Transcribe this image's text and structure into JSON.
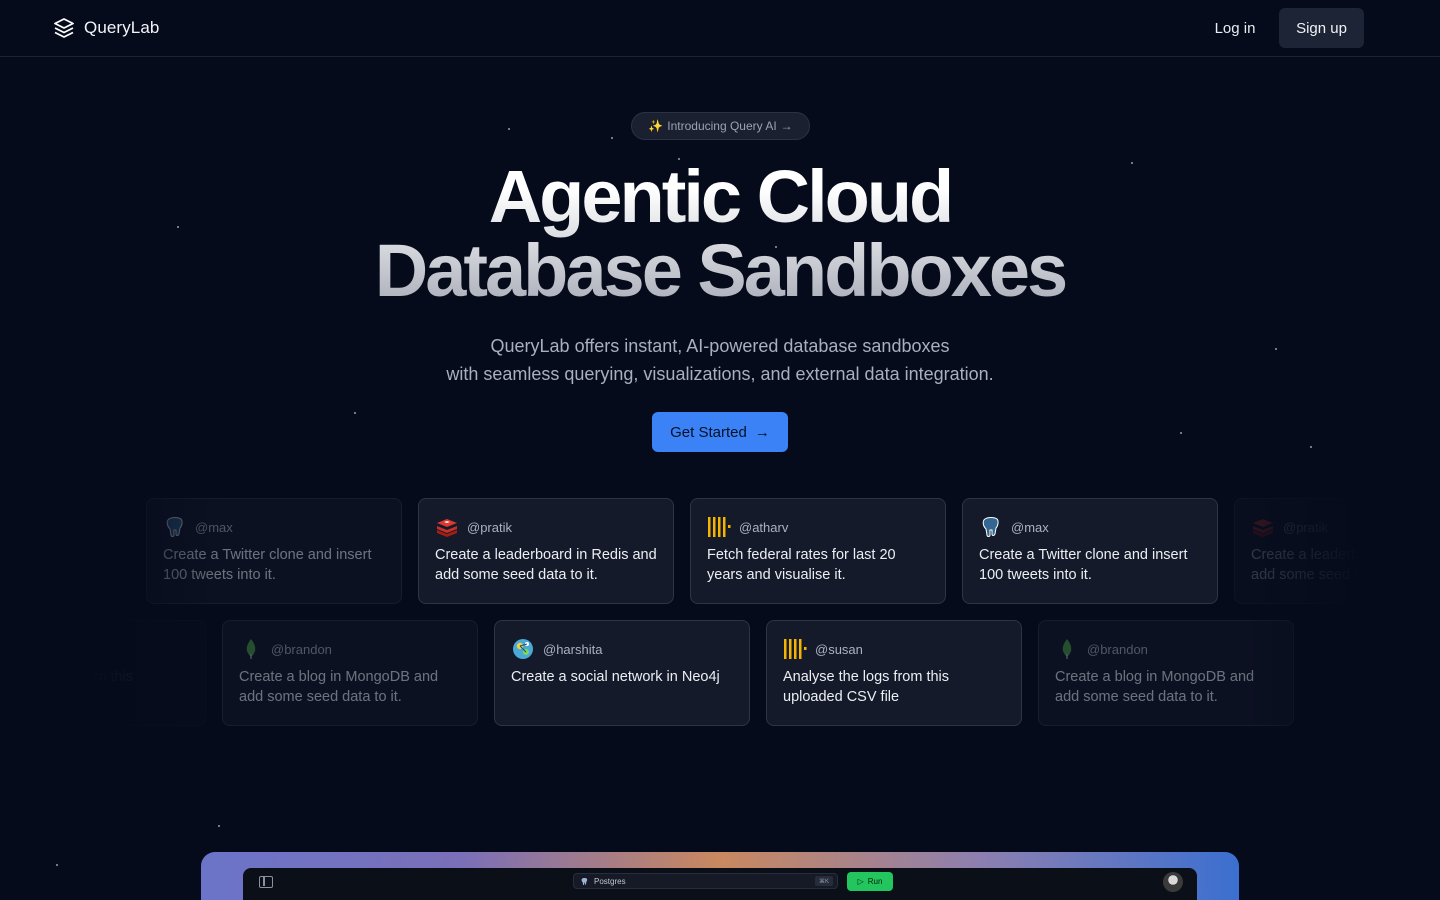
{
  "nav": {
    "brand": "QueryLab",
    "login_label": "Log in",
    "signup_label": "Sign up"
  },
  "hero": {
    "pill_icon": "sparkles-icon",
    "pill_label": "Introducing Query AI",
    "pill_arrow": "→",
    "headline_line1": "Agentic Cloud",
    "headline_line2": "Database Sandboxes",
    "subtitle_line1": "QueryLab offers instant, AI-powered database sandboxes",
    "subtitle_line2": "with seamless querying, visualizations, and external data integration.",
    "cta_label": "Get Started",
    "cta_arrow": "→"
  },
  "cards_row1": [
    {
      "icon": "postgres-icon",
      "user": "@max",
      "text": "Create a Twitter clone and insert 100 tweets into it."
    },
    {
      "icon": "redis-icon",
      "user": "@pratik",
      "text": "Create a leaderboard in Redis and add some seed data to it."
    },
    {
      "icon": "csv-icon",
      "user": "@atharv",
      "text": "Fetch federal rates for last 20 years and visualise it."
    },
    {
      "icon": "postgres-icon",
      "user": "@max",
      "text": "Create a Twitter clone and insert 100 tweets into it."
    },
    {
      "icon": "redis-icon",
      "user": "@pratik",
      "text": "Create a leaderboard in Redis and add some seed data to it."
    }
  ],
  "cards_row2": [
    {
      "icon": "csv-icon",
      "user": "@susan",
      "text": "Analyse the logs from this uploaded CSV file"
    },
    {
      "icon": "mongodb-icon",
      "user": "@brandon",
      "text": "Create a blog in MongoDB and add some seed data to it."
    },
    {
      "icon": "neo4j-icon",
      "user": "@harshita",
      "text": "Create a social network in Neo4j"
    },
    {
      "icon": "csv-icon",
      "user": "@susan",
      "text": "Analyse the logs from this uploaded CSV file"
    },
    {
      "icon": "mongodb-icon",
      "user": "@brandon",
      "text": "Create a blog in MongoDB and add some seed data to it."
    }
  ],
  "preview": {
    "db_label": "Postgres",
    "shortcut": "⌘K",
    "run_label": "Run"
  },
  "colors": {
    "background": "#060b1c",
    "accent": "#3b82f6",
    "run": "#22c55e"
  }
}
